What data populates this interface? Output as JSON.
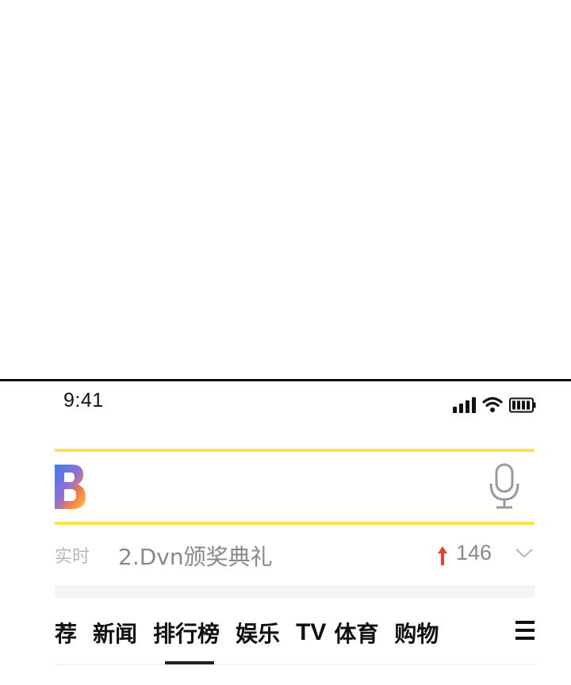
{
  "status_bar": {
    "time": "9:41",
    "icons": [
      "signal-icon",
      "wifi-icon",
      "battery-icon"
    ]
  },
  "search": {
    "logo_letter": "B",
    "placeholder": "",
    "value": "",
    "mic_icon": "microphone-icon",
    "accent_color": "#ffe24a"
  },
  "trending": {
    "tag": "实时",
    "text": "2.Dvn颁奖典礼",
    "arrow_icon": "up-arrow-icon",
    "arrow_color": "#e0452f",
    "count": "146",
    "chevron_icon": "chevron-down-icon"
  },
  "tabs": {
    "items": [
      {
        "label": "荐"
      },
      {
        "label": "新闻"
      },
      {
        "label": "排行榜"
      },
      {
        "label": "娱乐"
      },
      {
        "label": "TV"
      },
      {
        "label": "体育"
      },
      {
        "label": "购物"
      }
    ],
    "active_index": 2,
    "menu_icon": "hamburger-menu-icon"
  }
}
